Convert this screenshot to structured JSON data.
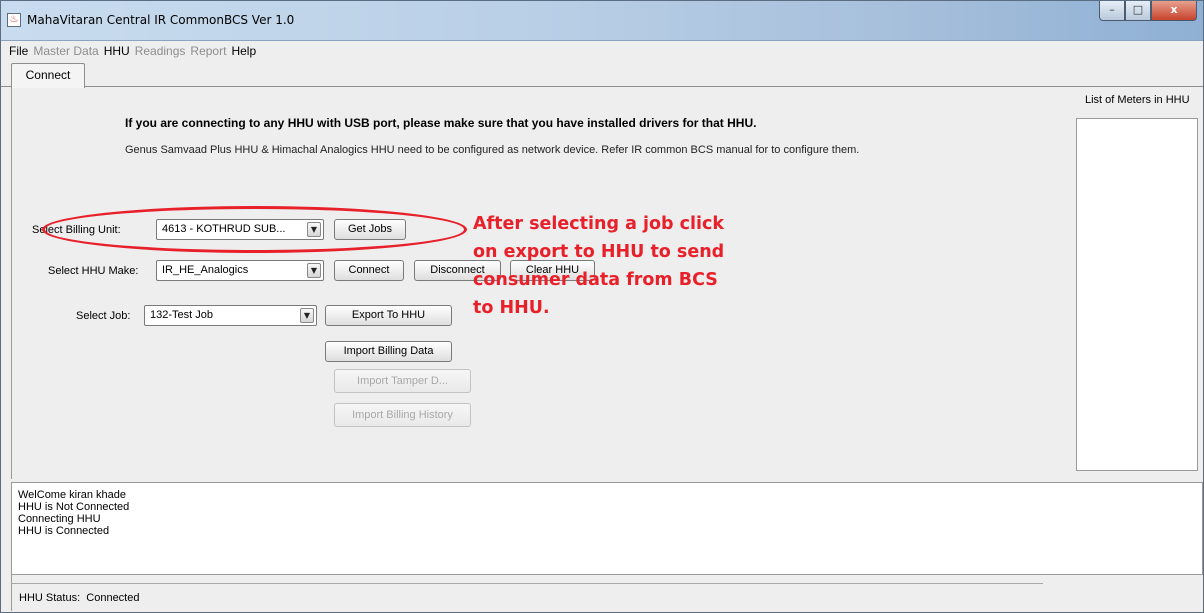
{
  "window": {
    "title": "MahaVitaran Central IR CommonBCS Ver 1.0",
    "app_icon": "java-cup-icon",
    "controls": {
      "minimize": "–",
      "maximize": "□",
      "close": "x"
    }
  },
  "menu": {
    "items": [
      {
        "label": "File",
        "enabled": true
      },
      {
        "label": "Master Data",
        "enabled": false
      },
      {
        "label": "HHU",
        "enabled": true
      },
      {
        "label": "Readings",
        "enabled": false
      },
      {
        "label": "Report",
        "enabled": false
      },
      {
        "label": "Help",
        "enabled": true
      }
    ]
  },
  "tabs": [
    {
      "label": "Connect",
      "active": true
    }
  ],
  "main": {
    "heading": "If you are connecting to any HHU with USB port, please make sure that you have installed drivers for that HHU.",
    "subheading": "Genus Samvaad Plus HHU & Himachal Analogics HHU need to be configured as network device. Refer IR common BCS manual for to configure them.",
    "meters_label": "List of Meters in HHU",
    "billing_unit": {
      "label": "Select Billing Unit:",
      "value": "4613 - KOTHRUD SUB..."
    },
    "hhu_make": {
      "label": "Select HHU Make:",
      "value": "IR_HE_Analogics"
    },
    "job": {
      "label": "Select Job:",
      "value": "132-Test Job"
    },
    "buttons": {
      "get_jobs": "Get Jobs",
      "connect": "Connect",
      "disconnect": "Disconnect",
      "clear_hhu": "Clear HHU",
      "export_to_hhu": "Export To HHU",
      "import_billing_data": "Import Billing Data",
      "import_tamper": "Import Tamper D...",
      "import_billing_history": "Import Billing History"
    },
    "dropdown_arrow": "▼"
  },
  "annotation": {
    "lines": [
      "After selecting a job click",
      "on export to HHU to send",
      "consumer data from BCS",
      "to HHU."
    ],
    "color": "#e8202a"
  },
  "log": {
    "lines": [
      "WelCome kiran khade",
      "HHU is Not Connected",
      "Connecting HHU",
      "HHU is Connected"
    ]
  },
  "status": {
    "label": "HHU Status:",
    "value": "Connected"
  }
}
